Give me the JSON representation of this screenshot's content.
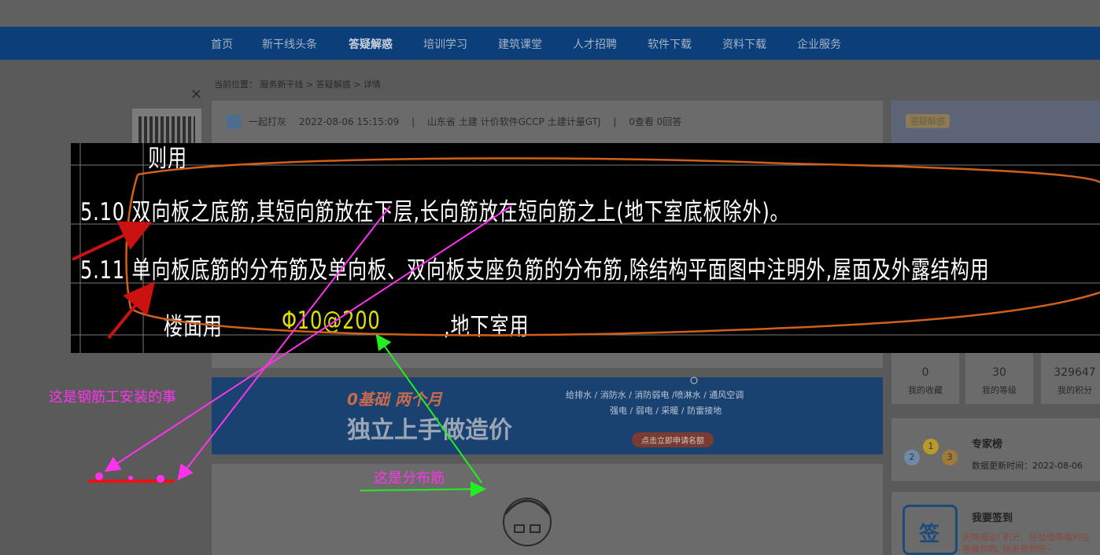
{
  "nav": {
    "items": [
      "首页",
      "新干线头条",
      "答疑解惑",
      "培训学习",
      "建筑课堂",
      "人才招聘",
      "软件下载",
      "资料下载",
      "企业服务"
    ],
    "active_index": 2
  },
  "breadcrumb": {
    "prefix": "当前位置：",
    "path": "服务新干线 > 答疑解惑 > 详情"
  },
  "post_meta": {
    "user": "一起打灰",
    "datetime": "2022-08-06 15:15:09",
    "sep1": "|",
    "tags": "山东省  土建 计价软件GCCP 土建计量GTJ",
    "sep2": "|",
    "views": "0查看  0回答"
  },
  "cad": {
    "line0": "则用",
    "line1": "5.10  双向板之底筋,其短向筋放在下层,长向筋放在短向筋之上(地下室底板除外)。",
    "line2": "5.11  单向板底筋的分布筋及单向板、双向板支座负筋的分布筋,除结构平面图中注明外,屋面及外露结构用",
    "line3_a": "楼面用",
    "line3_b": "Φ10@200",
    "line3_c": ",地下室用"
  },
  "annotations": {
    "left": "这是钢筋工安装的事",
    "right": "这是分布筋"
  },
  "banner": {
    "tag": "0基础  两个月",
    "headline": "独立上手做造价",
    "line1": "给排水 / 消防水 / 消防弱电 /喷淋水 / 通风空调",
    "line2": "强电 / 弱电 / 采暖 / 防雷接地",
    "button": "点击立即申请名额"
  },
  "sidebar": {
    "badge": "答疑解惑",
    "stats": [
      {
        "value": "0",
        "label": "我的收藏"
      },
      {
        "value": "30",
        "label": "我的等级"
      },
      {
        "value": "329647",
        "label": "我的积分"
      }
    ],
    "expert": {
      "title": "专家榜",
      "updated": "数据更新时间：2022-08-06",
      "medals": [
        "2",
        "1",
        "3"
      ]
    },
    "signin": {
      "title": "我要签到",
      "icon_char": "签",
      "text": "天降福运! 积分、经验值等福利在等着你哟, 快来签到吧~"
    }
  },
  "colors": {
    "nav_bg": "#0c3f7a",
    "cad_bg": "#000000",
    "cad_text": "#ffffff",
    "cad_highlight": "#e0e000",
    "annot_pink": "#ff33ee",
    "arrow_green": "#22ee22",
    "arrow_red": "#cc1111",
    "scribble_orange": "#d2601a"
  }
}
